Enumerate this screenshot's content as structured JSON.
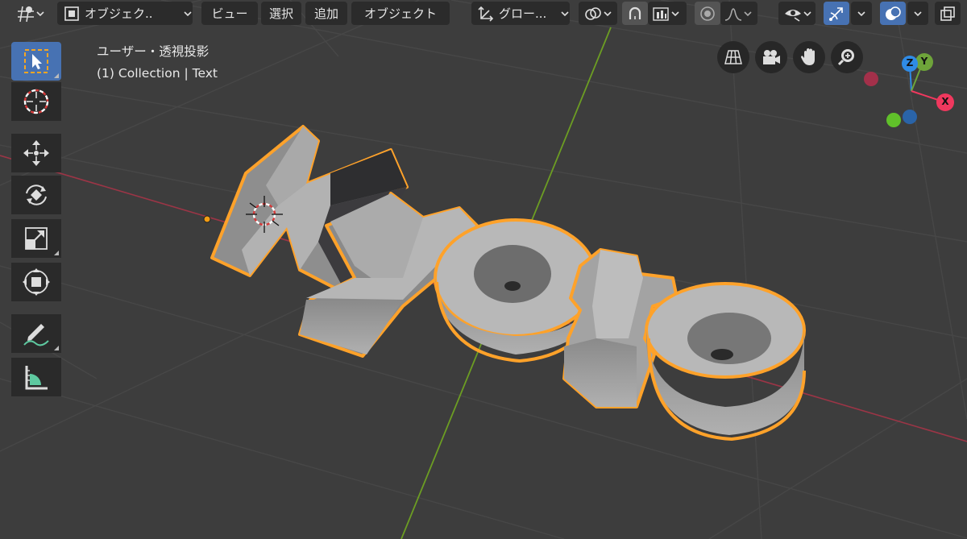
{
  "header": {
    "editor_type_icon": "3d-viewport-icon",
    "mode_label": "オブジェク..",
    "menus": [
      "ビュー",
      "選択",
      "追加",
      "オブジェクト"
    ],
    "orientation_label": "グロー...",
    "icons": {
      "pivot": "pivot-point-icon",
      "snap": "snap-magnet-icon",
      "snap_target": "snap-increment-icon",
      "proportional": "proportional-edit-icon",
      "falloff": "falloff-curve-icon",
      "visibility": "eye-icon",
      "gizmo": "gizmo-icon",
      "overlay": "overlay-icon",
      "xray": "xray-icon"
    }
  },
  "viewport": {
    "view_name": "ユーザー・透視投影",
    "object_info": "(1) Collection | Text",
    "text_object": "Kyoto",
    "colors": {
      "background": "#3d3d3d",
      "grid": "#4a4a4a",
      "x_axis": "#c23b52",
      "y_axis": "#6c9d23",
      "selection_outline": "#ffa22a",
      "mesh": "#a7a7a7"
    }
  },
  "toolbar": [
    {
      "name": "select-box-tool",
      "icon": "select-box-icon"
    },
    {
      "name": "cursor-tool",
      "icon": "cursor-icon"
    },
    {
      "name": "move-tool",
      "icon": "move-icon"
    },
    {
      "name": "rotate-tool",
      "icon": "rotate-icon"
    },
    {
      "name": "scale-tool",
      "icon": "scale-icon"
    },
    {
      "name": "transform-tool",
      "icon": "transform-icon"
    },
    {
      "name": "annotate-tool",
      "icon": "annotate-icon"
    },
    {
      "name": "measure-tool",
      "icon": "measure-icon"
    }
  ],
  "navigation": [
    {
      "name": "toggle-orthographic-button",
      "icon": "grid-icon"
    },
    {
      "name": "camera-view-button",
      "icon": "camera-icon"
    },
    {
      "name": "pan-view-button",
      "icon": "hand-icon"
    },
    {
      "name": "zoom-view-button",
      "icon": "zoom-icon"
    }
  ],
  "gizmo": {
    "x": "X",
    "y": "Y",
    "z": "Z",
    "colors": {
      "x": "#f0385e",
      "y": "#6ea43a",
      "z": "#2f8be6"
    }
  }
}
